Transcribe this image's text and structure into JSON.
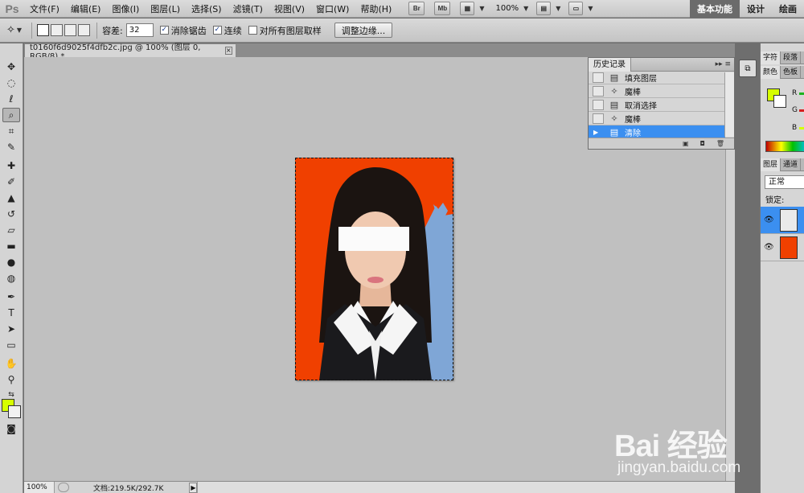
{
  "app": {
    "logo": "Ps"
  },
  "menu": [
    "文件(F)",
    "编辑(E)",
    "图像(I)",
    "图层(L)",
    "选择(S)",
    "滤镜(T)",
    "视图(V)",
    "窗口(W)",
    "帮助(H)"
  ],
  "appbar": {
    "bridge": "Br",
    "minibridge": "Mb",
    "zoom": "100%"
  },
  "workspaces": [
    "基本功能",
    "设计",
    "绘画"
  ],
  "options": {
    "tolerance_label": "容差:",
    "tolerance_value": "32",
    "antialias_label": "消除锯齿",
    "antialias_checked": true,
    "contiguous_label": "连续",
    "contiguous_checked": true,
    "sample_all_label": "对所有图层取样",
    "sample_all_checked": false,
    "refine_edge": "调整边缘..."
  },
  "document": {
    "tab_title": "t0160f6d9025f4dfb2c.jpg @ 100% (图层 0, RGB/8) *",
    "close": "×"
  },
  "history": {
    "title": "历史记录",
    "items": [
      {
        "label": "填充图层",
        "icon": "document-icon"
      },
      {
        "label": "魔棒",
        "icon": "magic-wand-icon"
      },
      {
        "label": "取消选择",
        "icon": "document-icon"
      },
      {
        "label": "魔棒",
        "icon": "magic-wand-icon"
      },
      {
        "label": "清除",
        "icon": "document-icon",
        "selected": true
      }
    ]
  },
  "right_panel": {
    "tabs_top": [
      "字符",
      "段落"
    ],
    "tabs_color": [
      "颜色",
      "色板"
    ],
    "rgb": [
      "R",
      "G",
      "B"
    ],
    "tabs_layers": [
      "图层",
      "通道"
    ],
    "blend_mode": "正常",
    "lock_label": "锁定:"
  },
  "status": {
    "zoom": "100%",
    "doc_size": "文档:219.5K/292.7K"
  },
  "colors": {
    "foreground": "#d6ff00",
    "background": "#ffffff",
    "photo_bg": "#f04000",
    "selection_highlight": "#3b8ff0"
  },
  "watermark": {
    "main": "Bai 经验",
    "sub": "jingyan.baidu.com"
  }
}
